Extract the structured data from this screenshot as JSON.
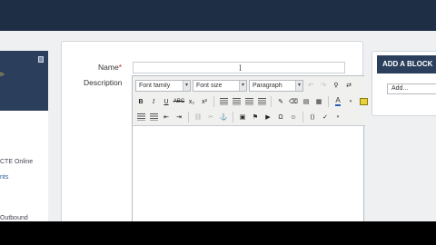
{
  "left_panel": {
    "links": [
      {
        "text": "CTE Online",
        "style": "dark"
      },
      {
        "text": "nts",
        "style": "blue"
      },
      {
        "text": "Outbound",
        "style": "dark"
      }
    ]
  },
  "form": {
    "name_label": "Name",
    "required_mark": "*",
    "name_value": "",
    "description_label": "Description"
  },
  "editor": {
    "font_family": "Font family",
    "font_size": "Font size",
    "format": "Paragraph",
    "toolbar_row2": [
      "B",
      "I",
      "U",
      "ABC",
      "x₂",
      "x²"
    ],
    "dropdown_arrow": "▾",
    "body_text": ""
  },
  "blocks": {
    "title": "ADD A BLOCK",
    "select_value": "Add..."
  },
  "colors": {
    "topbar": "#1e2e44",
    "block_header": "#2b3f5c",
    "required": "#c0262d",
    "link": "#2a5a93"
  }
}
